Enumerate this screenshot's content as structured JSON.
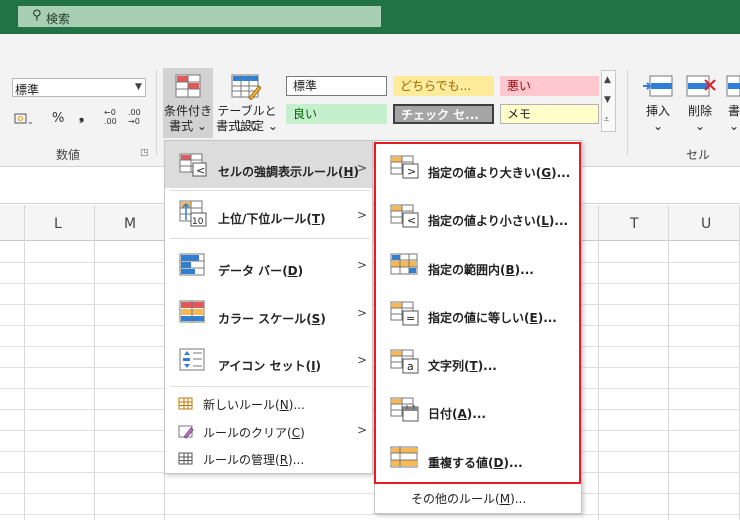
{
  "search": {
    "placeholder": "検索"
  },
  "ribbon": {
    "number_format": "標準",
    "number_buttons": [
      "%",
      "❟",
      "←0 .00",
      ".00 →0"
    ],
    "group_number": "数値",
    "cf_button": {
      "line1": "条件付き",
      "line2": "書式 ⌄"
    },
    "table_button": {
      "line1": "テーブルとして",
      "line2": "書式設定 ⌄"
    },
    "styles": [
      {
        "label": "標準",
        "bg": "#ffffff",
        "color": "#222222",
        "border": "#7a7a7a"
      },
      {
        "label": "どちらでも...",
        "bg": "#ffeb9c",
        "color": "#9c6500",
        "border": "#ffeb9c"
      },
      {
        "label": "悪い",
        "bg": "#ffc7ce",
        "color": "#9c0006",
        "border": "#ffc7ce"
      },
      {
        "label": "良い",
        "bg": "#c6efce",
        "color": "#006100",
        "border": "#c6efce"
      },
      {
        "label": "チェック セ...",
        "bg": "#a5a5a5",
        "color": "#ffffff",
        "border": "#3f3f3f"
      },
      {
        "label": "メモ",
        "bg": "#ffffcc",
        "color": "#222222",
        "border": "#b2b2b2"
      }
    ],
    "insert_label": "挿入",
    "delete_label": "削除",
    "format_label": "書",
    "group_cells": "セル"
  },
  "columns": [
    "L",
    "M",
    "T",
    "U"
  ],
  "menu_main": {
    "items": [
      {
        "label": "セルの強調表示ルール",
        "key": "H",
        "icon": "highlight-rules-icon"
      },
      {
        "label": "上位/下位ルール",
        "key": "T",
        "icon": "top-bottom-icon"
      },
      {
        "label": "データ バー",
        "key": "D",
        "icon": "data-bar-icon"
      },
      {
        "label": "カラー スケール",
        "key": "S",
        "icon": "color-scale-icon"
      },
      {
        "label": "アイコン セット",
        "key": "I",
        "icon": "icon-set-icon"
      }
    ],
    "small_items": [
      {
        "label": "新しいルール",
        "key": "N",
        "suffix": "..."
      },
      {
        "label": "ルールのクリア",
        "key": "C",
        "suffix": ""
      },
      {
        "label": "ルールの管理",
        "key": "R",
        "suffix": "..."
      }
    ]
  },
  "menu_sub": {
    "items": [
      {
        "label": "指定の値より大きい",
        "key": "G",
        "glyph": ">"
      },
      {
        "label": "指定の値より小さい",
        "key": "L",
        "glyph": "<"
      },
      {
        "label": "指定の範囲内",
        "key": "B",
        "glyph": ""
      },
      {
        "label": "指定の値に等しい",
        "key": "E",
        "glyph": "="
      },
      {
        "label": "文字列",
        "key": "T",
        "glyph": "a"
      },
      {
        "label": "日付",
        "key": "A",
        "glyph": ""
      },
      {
        "label": "重複する値",
        "key": "D",
        "glyph": ""
      }
    ],
    "more": {
      "label": "その他のルール",
      "key": "M"
    }
  },
  "colors": {
    "brand": "#217346",
    "highlight_box": "#e51c23",
    "icon_orange": "#f7b955",
    "icon_blue": "#2f7fd6",
    "icon_red": "#e05a5a"
  }
}
